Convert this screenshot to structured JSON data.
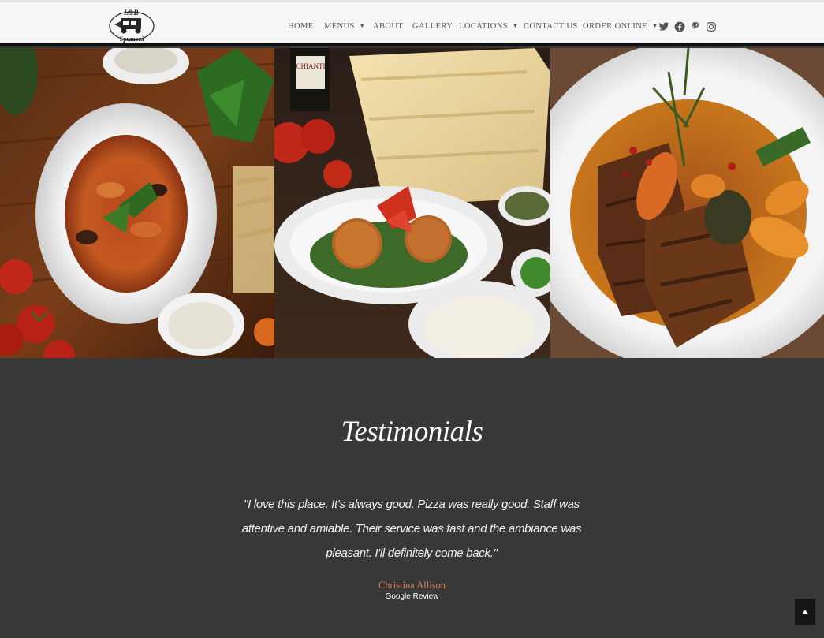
{
  "brand": {
    "logo_text": "Spumoni Gardens",
    "logo_mark": "L&B"
  },
  "nav": {
    "items": [
      {
        "label": "HOME",
        "dropdown": false
      },
      {
        "label": "MENUS",
        "dropdown": true
      },
      {
        "label": "ABOUT",
        "dropdown": false
      },
      {
        "label": "GALLERY",
        "dropdown": false
      },
      {
        "label": "LOCATIONS",
        "dropdown": true
      },
      {
        "label": "CONTACT US",
        "dropdown": false
      },
      {
        "label": "ORDER ONLINE",
        "dropdown": true
      }
    ],
    "social": [
      "twitter-icon",
      "facebook-icon",
      "pinterest-icon",
      "instagram-icon"
    ]
  },
  "hero": {
    "panels": [
      {
        "name": "pasta-dish-photo"
      },
      {
        "name": "arancini-dish-photo"
      },
      {
        "name": "chicken-dish-photo"
      }
    ]
  },
  "testimonials": {
    "title": "Testimonials",
    "quote": "\"I love this place. It's always good. Pizza was really good. Staff was attentive and amiable. Their service was fast and the ambiance was pleasant. I'll definitely come back.\"",
    "author": "Christina Allison",
    "source": "Google Review"
  },
  "colors": {
    "header_bg": "#f7f7f7",
    "section_bg": "#383838",
    "accent": "#d0825a",
    "nav_text": "#555555"
  },
  "back_to_top_icon": "arrow-up-icon"
}
